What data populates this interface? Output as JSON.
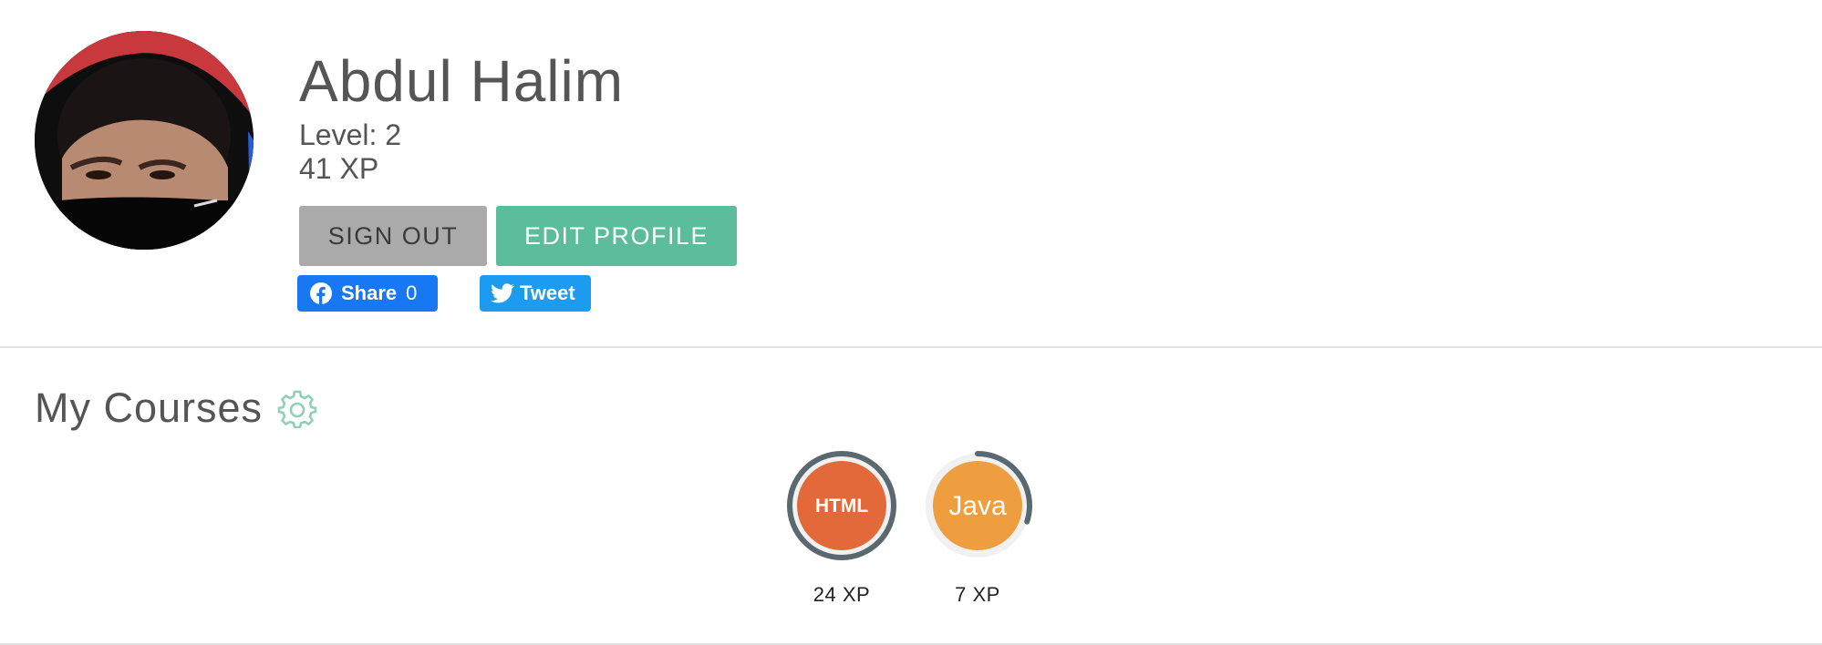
{
  "profile": {
    "name": "Abdul Halim",
    "level": "Level: 2",
    "xp": "41 XP"
  },
  "actions": {
    "sign_out_label": "SIGN OUT",
    "edit_profile_label": "EDIT PROFILE"
  },
  "social": {
    "share_label": "Share",
    "share_count": "0",
    "tweet_label": "Tweet"
  },
  "courses": {
    "title": "My Courses",
    "items": [
      {
        "badge": "HTML",
        "xp": "24 XP",
        "color": "#e4693a",
        "progress": 1.0
      },
      {
        "badge": "Java",
        "xp": "7 XP",
        "color": "#ee9d3f",
        "progress": 0.3
      }
    ]
  },
  "colors": {
    "accent": "#5bbd9b",
    "sign_out_bg": "#aaaaaa",
    "facebook": "#1877f2",
    "twitter": "#1d9bf0"
  },
  "icons": [
    "facebook-icon",
    "twitter-icon",
    "gear-icon"
  ]
}
